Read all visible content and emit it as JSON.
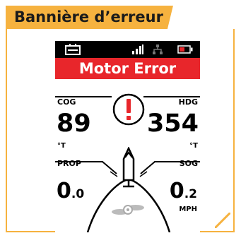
{
  "banner": {
    "label": "Bannière d’erreur"
  },
  "status_icons": [
    "battery-icon",
    "signal-icon",
    "network-icon",
    "low-battery-icon"
  ],
  "error": {
    "text": "Motor Error"
  },
  "gauges": {
    "cog": {
      "label": "COG",
      "value": "89",
      "unit": "°T"
    },
    "hdg": {
      "label": "HDG",
      "value": "354",
      "unit": "°T"
    },
    "prop": {
      "label": "PROP",
      "value_int": "0",
      "value_dec": ".0"
    },
    "sog": {
      "label": "SOG",
      "value_int": "0",
      "value_dec": ".2",
      "unit": "MPH"
    }
  },
  "colors": {
    "accent": "#f6b23f",
    "error": "#e8262b",
    "status_low": "#e8262b"
  }
}
